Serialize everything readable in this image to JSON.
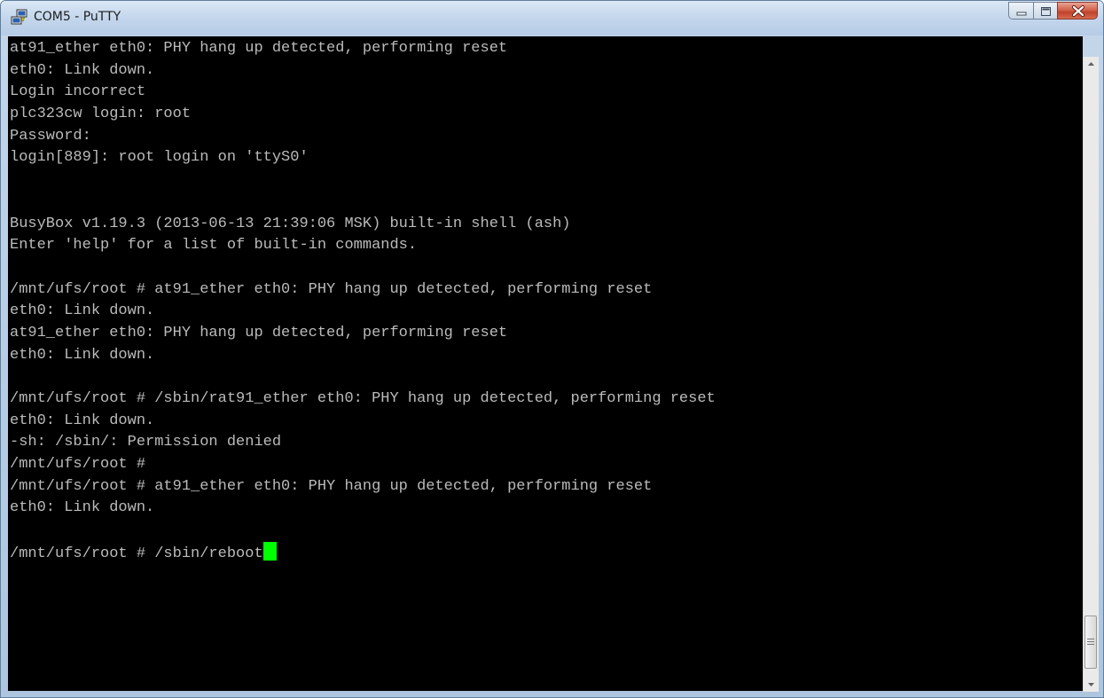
{
  "window": {
    "title": "COM5 - PuTTY",
    "app_icon": "putty-computers-icon",
    "controls": [
      "minimize-icon",
      "maximize-icon",
      "close-icon"
    ]
  },
  "terminal": {
    "background": "#000000",
    "foreground": "#bbbbbb",
    "cursor_color": "#00ff00",
    "lines": [
      "at91_ether eth0: PHY hang up detected, performing reset",
      "eth0: Link down.",
      "Login incorrect",
      "plc323cw login: root",
      "Password:",
      "login[889]: root login on 'ttyS0'",
      "",
      "",
      "BusyBox v1.19.3 (2013-06-13 21:39:06 MSK) built-in shell (ash)",
      "Enter 'help' for a list of built-in commands.",
      "",
      "/mnt/ufs/root # at91_ether eth0: PHY hang up detected, performing reset",
      "eth0: Link down.",
      "at91_ether eth0: PHY hang up detected, performing reset",
      "eth0: Link down.",
      "",
      "/mnt/ufs/root # /sbin/rat91_ether eth0: PHY hang up detected, performing reset",
      "eth0: Link down.",
      "-sh: /sbin/: Permission denied",
      "/mnt/ufs/root #",
      "/mnt/ufs/root # at91_ether eth0: PHY hang up detected, performing reset",
      "eth0: Link down.",
      "",
      "/mnt/ufs/root # /sbin/reboot"
    ]
  },
  "scrollbar": {
    "up_icon": "scroll-up-arrow-icon",
    "down_icon": "scroll-down-arrow-icon",
    "position": "bottom"
  }
}
